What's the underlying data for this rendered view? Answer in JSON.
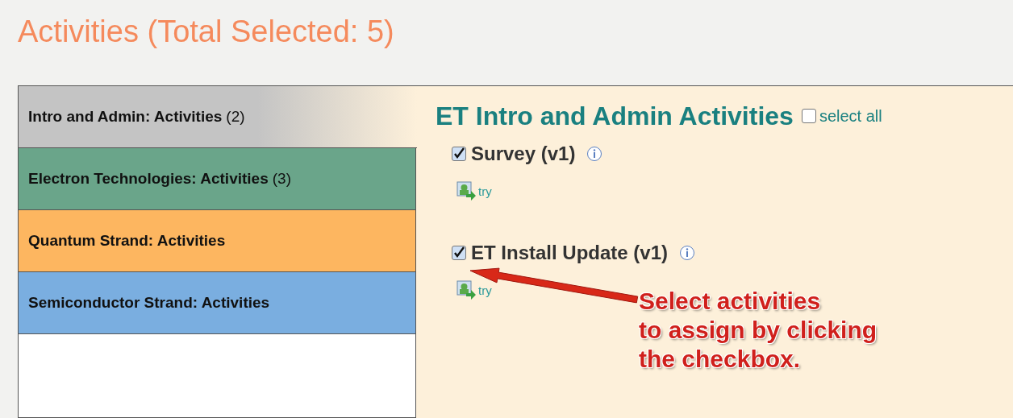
{
  "title": "Activities (Total Selected: 5)",
  "categories": [
    {
      "label": "Intro and Admin: Activities",
      "count": "(2)",
      "color": "#c4c4c4",
      "selected": true
    },
    {
      "label": "Electron Technologies: Activities",
      "count": "(3)",
      "color": "#6aa58a",
      "selected": false
    },
    {
      "label": "Quantum Strand: Activities",
      "color": "#fdb660",
      "selected": false
    },
    {
      "label": "Semiconductor Strand: Activities",
      "color": "#7aaee0",
      "selected": false
    }
  ],
  "content": {
    "heading": "ET Intro and Admin Activities",
    "select_all": {
      "label": "select all",
      "checked": false
    },
    "activities": [
      {
        "name": "Survey (v1)",
        "checked": true,
        "action": "try"
      },
      {
        "name": "ET Install Update (v1)",
        "checked": true,
        "action": "try"
      }
    ]
  },
  "callout": {
    "text": "Select activities\nto assign by clicking\nthe checkbox."
  }
}
